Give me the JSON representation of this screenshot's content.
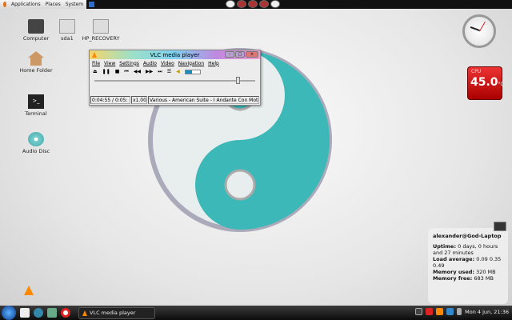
{
  "top_panel": {
    "menus": [
      "Applications",
      "Places",
      "System"
    ]
  },
  "desktop_icons": [
    {
      "label": "Computer"
    },
    {
      "label": "sda1"
    },
    {
      "label": "HP_RECOVERY"
    },
    {
      "label": "Home Folder"
    },
    {
      "label": "Terminal"
    },
    {
      "label": "Audio Disc"
    }
  ],
  "vlc": {
    "title": "VLC media player",
    "menu": [
      "File",
      "View",
      "Settings",
      "Audio",
      "Video",
      "Navigation",
      "Help"
    ],
    "time": "0:04:55 / 0:05:",
    "speed": "x1.00",
    "track": "Various - American Suite - I Andante Con Moto",
    "volume": 0.45,
    "seek_position": 0.88
  },
  "cpu_widget": {
    "label": "CPU",
    "value": "45.0",
    "unit": "°C"
  },
  "sysinfo": {
    "host": "alexander@God-Laptop",
    "uptime_label": "Uptime:",
    "uptime": "0 days, 0 hours and 27 minutes",
    "load_label": "Load average:",
    "load": "0.09 0.35 0.49",
    "mem_used_label": "Memory used:",
    "mem_used": "320 MB",
    "mem_free_label": "Memory free:",
    "mem_free": "683 MB"
  },
  "taskbar": {
    "task": "VLC media player",
    "clock": "Mon  4 jun, 21:36"
  }
}
